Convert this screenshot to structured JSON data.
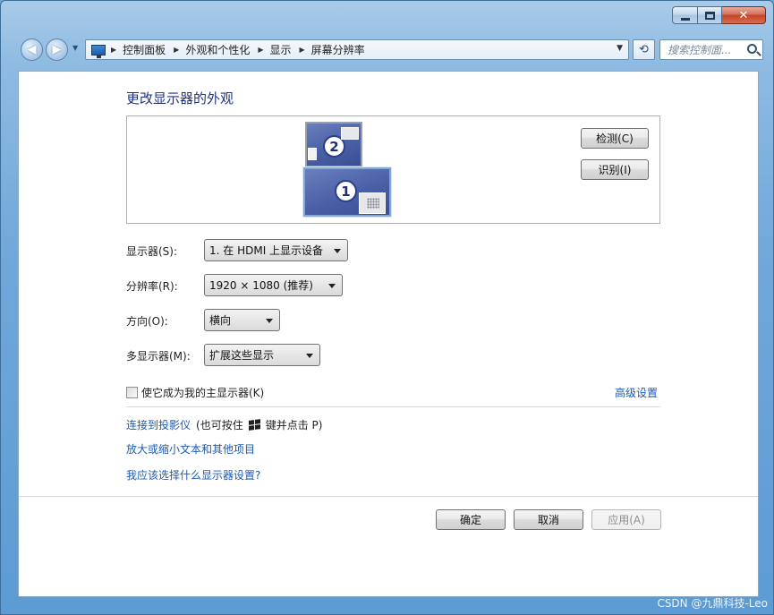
{
  "window": {
    "caption": {
      "minimize": "",
      "maximize": "",
      "close": "✕"
    }
  },
  "nav": {
    "back": "◀",
    "forward": "▶",
    "recent": "▼",
    "breadcrumb": [
      "控制面板",
      "外观和个性化",
      "显示",
      "屏幕分辨率"
    ],
    "refresh": "⟲",
    "search_placeholder": "搜索控制面..."
  },
  "main": {
    "title": "更改显示器的外观",
    "monitors": [
      {
        "number": "2"
      },
      {
        "number": "1",
        "selected": true
      }
    ],
    "detect_button": "检测(C)",
    "identify_button": "识别(I)",
    "fields": {
      "display": {
        "label": "显示器(S):",
        "value": "1. 在 HDMI 上显示设备"
      },
      "resolution": {
        "label": "分辨率(R):",
        "value": "1920 × 1080 (推荐)"
      },
      "orientation": {
        "label": "方向(O):",
        "value": "横向"
      },
      "multiple": {
        "label": "多显示器(M):",
        "value": "扩展这些显示"
      }
    },
    "primary_checkbox": "使它成为我的主显示器(K)",
    "advanced_link": "高级设置",
    "projector_link": "连接到投影仪",
    "projector_hint_before": "(也可按住",
    "projector_hint_after": "键并点击 P)",
    "text_size_link": "放大或缩小文本和其他项目",
    "help_link": "我应该选择什么显示器设置?"
  },
  "footer": {
    "ok": "确定",
    "cancel": "取消",
    "apply": "应用(A)"
  },
  "watermark": "CSDN @九鼎科技-Leo",
  "colors": {
    "link": "#1c5ab5",
    "heading": "#1e3287",
    "close_button": "#c4442a"
  }
}
